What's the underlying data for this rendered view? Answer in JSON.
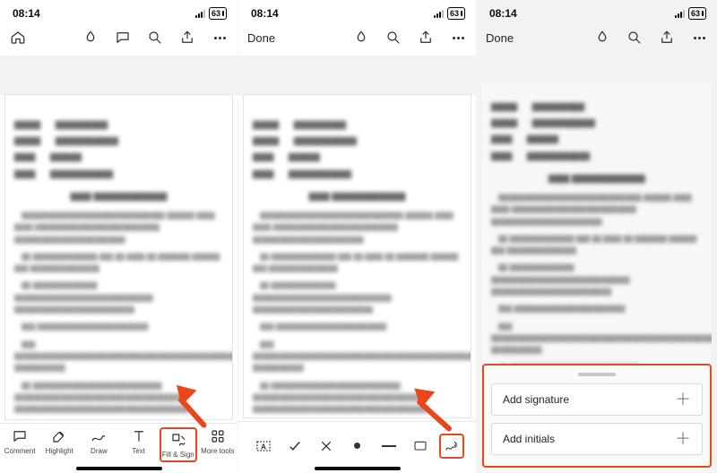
{
  "status": {
    "time": "08:14",
    "battery": "63"
  },
  "screen1": {
    "toolbar": {
      "comment_label": "Comment",
      "highlight_label": "Highlight",
      "draw_label": "Draw",
      "text_label": "Text",
      "fill_sign_label": "Fill & Sign",
      "more_tools_label": "More tools"
    }
  },
  "screen2": {
    "done_label": "Done",
    "fill_tools": {
      "textbox": "text-box",
      "check": "checkmark",
      "cross": "cross",
      "dot": "dot",
      "dash": "dash",
      "rect": "rectangle",
      "sign": "signature"
    }
  },
  "screen3": {
    "done_label": "Done",
    "sheet": {
      "add_signature": "Add signature",
      "add_initials": "Add initials"
    }
  },
  "arrows": {
    "a1_target": "fill-and-sign-button",
    "a2_target": "signature-tool-button"
  }
}
